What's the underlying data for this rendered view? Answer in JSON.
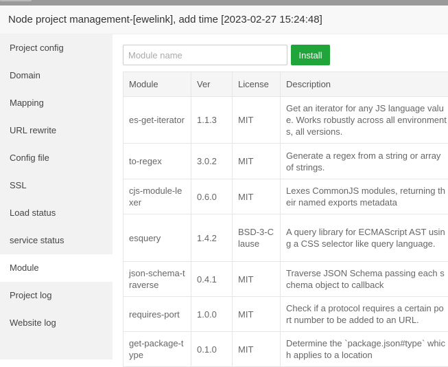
{
  "window": {
    "title": "Node project management-[ewelink], add time [2023-02-27 15:24:48]"
  },
  "sidebar": {
    "items": [
      {
        "label": "Project config"
      },
      {
        "label": "Domain"
      },
      {
        "label": "Mapping"
      },
      {
        "label": "URL rewrite"
      },
      {
        "label": "Config file"
      },
      {
        "label": "SSL"
      },
      {
        "label": "Load status"
      },
      {
        "label": "service status"
      },
      {
        "label": "Module",
        "active": true
      },
      {
        "label": "Project log"
      },
      {
        "label": "Website log"
      }
    ]
  },
  "toolbar": {
    "placeholder": "Module name",
    "install_label": "Install"
  },
  "table": {
    "headers": [
      "Module",
      "Ver",
      "License",
      "Description"
    ],
    "rows": [
      {
        "module": "es-get-iterator",
        "ver": "1.1.3",
        "license": "MIT",
        "desc": "Get an iterator for any JS language value. Works robustly across all environments, all versions."
      },
      {
        "module": "to-regex",
        "ver": "3.0.2",
        "license": "MIT",
        "desc": "Generate a regex from a string or array of strings."
      },
      {
        "module": "cjs-module-lexer",
        "ver": "0.6.0",
        "license": "MIT",
        "desc": "Lexes CommonJS modules, returning their named exports metadata"
      },
      {
        "module": "esquery",
        "ver": "1.4.2",
        "license": "BSD-3-Clause",
        "desc": "A query library for ECMAScript AST using a CSS selector like query language."
      },
      {
        "module": "json-schema-traverse",
        "ver": "0.4.1",
        "license": "MIT",
        "desc": "Traverse JSON Schema passing each schema object to callback"
      },
      {
        "module": "requires-port",
        "ver": "1.0.0",
        "license": "MIT",
        "desc": "Check if a protocol requires a certain port number to be added to an URL."
      },
      {
        "module": "get-package-type",
        "ver": "0.1.0",
        "license": "MIT",
        "desc": "Determine the `package.json#type` which applies to a location"
      }
    ]
  }
}
